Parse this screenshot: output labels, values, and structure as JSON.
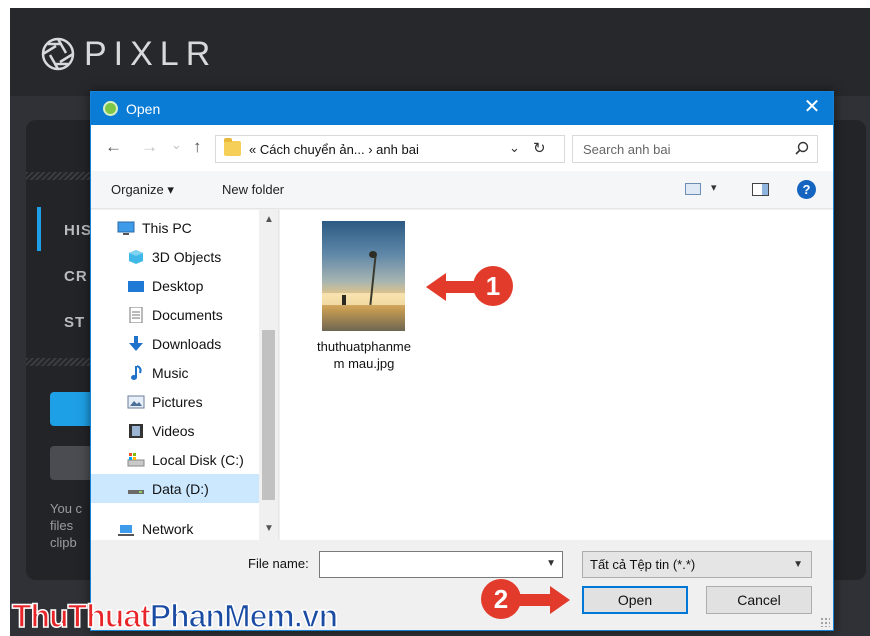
{
  "pixlr": {
    "logo": "PIXLR",
    "sidebar": [
      "HIS",
      "CR",
      "ST"
    ],
    "info_text": "You c\nfiles\nclipb"
  },
  "dialog": {
    "title": "Open",
    "close": "✕",
    "nav": {
      "back": "←",
      "forward": "→",
      "recent": "⌄",
      "up": "↑"
    },
    "address": {
      "text": "«  Cách chuyển ản...  ›  anh bai",
      "chevron": "⌄",
      "refresh": "↻"
    },
    "search": {
      "placeholder": "Search anh bai"
    },
    "toolbar": {
      "organize": "Organize ▾",
      "new_folder": "New folder",
      "view_caret": "▾",
      "help": "?"
    },
    "nav_items": [
      {
        "label": "This PC",
        "icon": "pc-icon"
      },
      {
        "label": "3D Objects",
        "icon": "cube-icon"
      },
      {
        "label": "Desktop",
        "icon": "desktop-icon"
      },
      {
        "label": "Documents",
        "icon": "documents-icon"
      },
      {
        "label": "Downloads",
        "icon": "download-icon"
      },
      {
        "label": "Music",
        "icon": "music-icon"
      },
      {
        "label": "Pictures",
        "icon": "pictures-icon"
      },
      {
        "label": "Videos",
        "icon": "videos-icon"
      },
      {
        "label": "Local Disk (C:)",
        "icon": "disk-icon"
      },
      {
        "label": "Data (D:)",
        "icon": "drive-icon"
      },
      {
        "label": "Network",
        "icon": "network-icon"
      }
    ],
    "file": {
      "name_line1": "thuthuatphanme",
      "name_line2": "m mau.jpg"
    },
    "filename_label": "File name:",
    "filename_value": "",
    "filter": "Tất cả Tệp tin (*.*)",
    "buttons": {
      "open": "Open",
      "cancel": "Cancel"
    }
  },
  "annotations": {
    "step1": "1",
    "step2": "2"
  },
  "watermark": {
    "part1": "Thu",
    "part2": "Thuat",
    "part3": "Phan",
    "part4": "Mem",
    "part5": ".vn"
  }
}
